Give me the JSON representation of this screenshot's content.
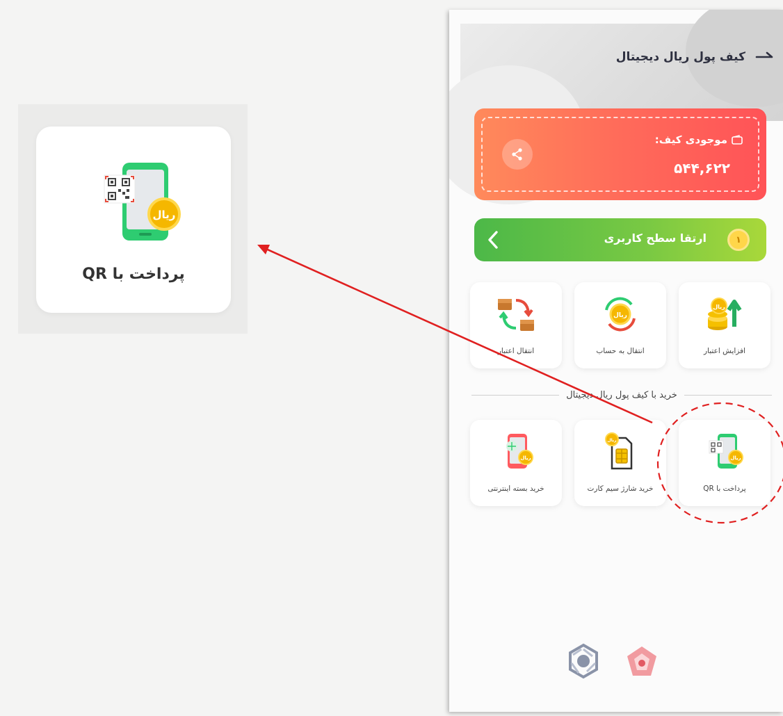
{
  "callout": {
    "label": "پرداخت با QR"
  },
  "header": {
    "title": "کیف پول ریال دیجیتال"
  },
  "wallet": {
    "title": "موجودی کیف:",
    "amount": "۵۴۴,۶۲۲"
  },
  "upgrade": {
    "label": "ارتقا سطح کاربری",
    "coin": "۱"
  },
  "top_tiles": [
    {
      "label": "افزایش اعتبار",
      "icon": "coins-up-icon"
    },
    {
      "label": "انتقال به حساب",
      "icon": "coin-transfer-icon"
    },
    {
      "label": "انتقال اعتبار",
      "icon": "wallet-exchange-icon"
    }
  ],
  "section": {
    "title": "خرید با کیف پول ریال دیجیتال"
  },
  "bottom_tiles": [
    {
      "label": "پرداخت با QR",
      "icon": "qr-phone-icon"
    },
    {
      "label": "خرید شارژ سیم کارت",
      "icon": "sim-card-icon"
    },
    {
      "label": "خرید بسته اینترنتی",
      "icon": "internet-phone-icon"
    }
  ],
  "coin_text": "ریال",
  "colors": {
    "wallet_gradient_start": "#ff8a5b",
    "wallet_gradient_end": "#ff5357",
    "upgrade_gradient_start": "#4cb848",
    "upgrade_gradient_end": "#a9d83a",
    "annotation_red": "#e02020"
  }
}
